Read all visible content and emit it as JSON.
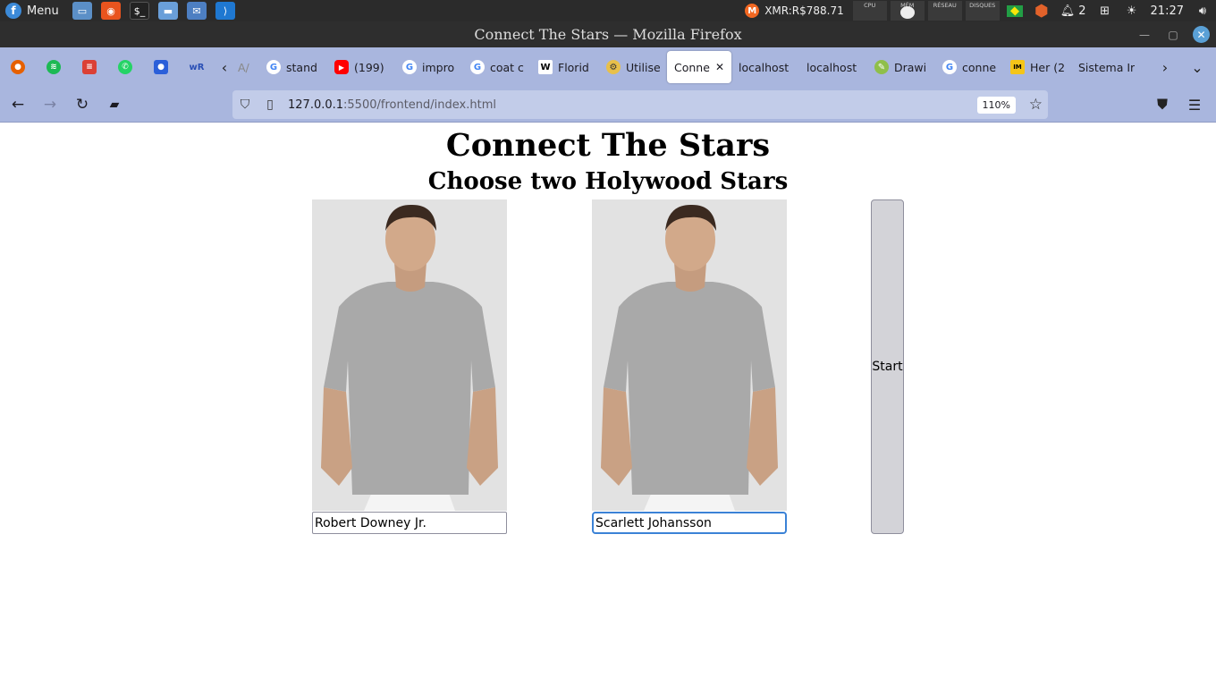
{
  "desktop_panel": {
    "menu_label": "Menu",
    "xmr_text": "XMR:R$788.71",
    "monitors": [
      "CPU",
      "MÉM",
      "RÉSEAU",
      "DISQUES"
    ],
    "notifications_count": "2",
    "clock": "21:27"
  },
  "window": {
    "title": "Connect The Stars — Mozilla Firefox"
  },
  "tabs": [
    {
      "label": "A/"
    },
    {
      "label": "stand"
    },
    {
      "label": "(199)"
    },
    {
      "label": "impro"
    },
    {
      "label": "coat c"
    },
    {
      "label": "Florid"
    },
    {
      "label": "Utilise"
    },
    {
      "label": "Connec",
      "active": true
    },
    {
      "label": "localhost"
    },
    {
      "label": "localhost"
    },
    {
      "label": "Drawi"
    },
    {
      "label": "conne"
    },
    {
      "label": "Her (2"
    },
    {
      "label": "Sistema Ir"
    }
  ],
  "navbar": {
    "url_host": "127.0.0.1",
    "url_path": ":5500/frontend/index.html",
    "zoom": "110%"
  },
  "page": {
    "title": "Connect The Stars",
    "subtitle": "Choose two Holywood Stars",
    "star1_value": "Robert Downey Jr.",
    "star2_value": "Scarlett Johansson",
    "start_label": "Start"
  },
  "colors": {
    "toolbar_bg": "#a9b6de",
    "urlbar_bg": "#c2cce9",
    "panel_bg": "#2b2b2b",
    "focus_ring": "#3b82d6"
  }
}
